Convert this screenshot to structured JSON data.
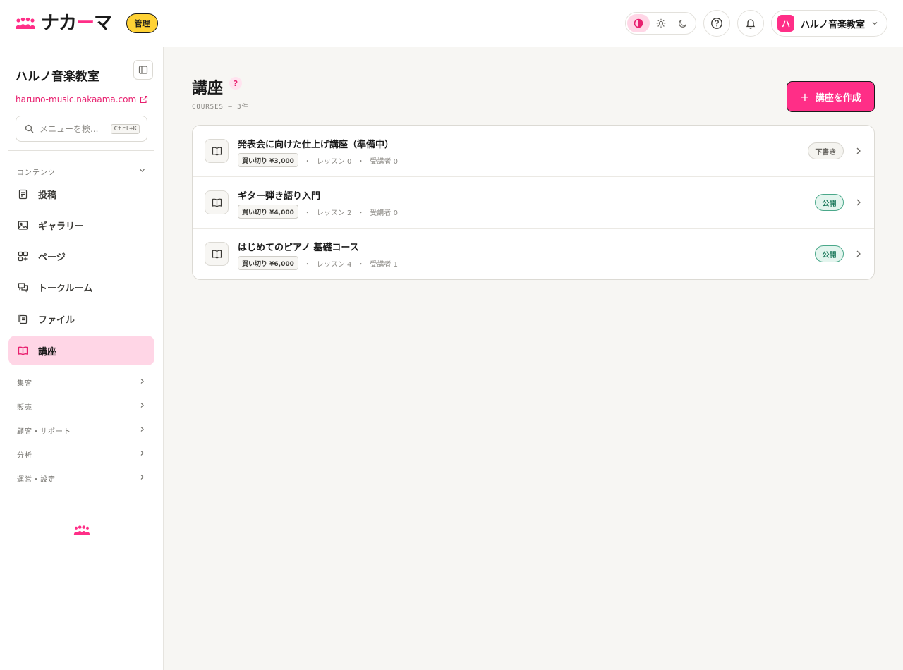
{
  "header": {
    "logo_text_pre": "ナカ",
    "logo_text_dash": "ー",
    "logo_text_post": "マ",
    "admin_badge": "管理",
    "account_initial": "ハ",
    "account_name": "ハルノ音楽教室",
    "icons": [
      "contrast-icon",
      "sun-icon",
      "moon-icon",
      "help-icon",
      "bell-icon",
      "chevron-down-icon"
    ],
    "active_theme": "auto"
  },
  "sidebar": {
    "site_name": "ハルノ音楽教室",
    "site_url": "haruno-music.nakaama.com",
    "search_placeholder": "メニューを検...",
    "search_shortcut": "Ctrl+K",
    "sections": [
      {
        "label": "コンテンツ",
        "expanded": true
      },
      {
        "label": "集客"
      },
      {
        "label": "販売"
      },
      {
        "label": "顧客・サポート"
      },
      {
        "label": "分析"
      },
      {
        "label": "運営・設定"
      }
    ],
    "items": [
      {
        "label": "投稿",
        "icon": "document-icon"
      },
      {
        "label": "ギャラリー",
        "icon": "image-icon"
      },
      {
        "label": "ページ",
        "icon": "pages-icon"
      },
      {
        "label": "トークルーム",
        "icon": "chat-icon"
      },
      {
        "label": "ファイル",
        "icon": "files-icon"
      },
      {
        "label": "講座",
        "icon": "book-icon",
        "active": true
      }
    ]
  },
  "main": {
    "title": "講座",
    "help": "?",
    "subtitle": "COURSES — 3件",
    "create_button": "講座を作成",
    "create_plus": "+",
    "courses": [
      {
        "title": "発表会に向けた仕上げ講座（準備中）",
        "price": "買い切り ¥3,000",
        "lessons": "レッスン 0",
        "students": "受講者 0",
        "status": "下書き"
      },
      {
        "title": "ギター弾き語り入門",
        "price": "買い切り ¥4,000",
        "lessons": "レッスン 2",
        "students": "受講者 0",
        "status": "公開"
      },
      {
        "title": "はじめてのピアノ 基礎コース",
        "price": "買い切り ¥6,000",
        "lessons": "レッスン 4",
        "students": "受講者 1",
        "status": "公開"
      }
    ],
    "meta_separator": "・"
  },
  "colors": {
    "accent": "#ff2e87",
    "badge_yellow": "#ffd235",
    "public_green": "#1d7a5c"
  }
}
